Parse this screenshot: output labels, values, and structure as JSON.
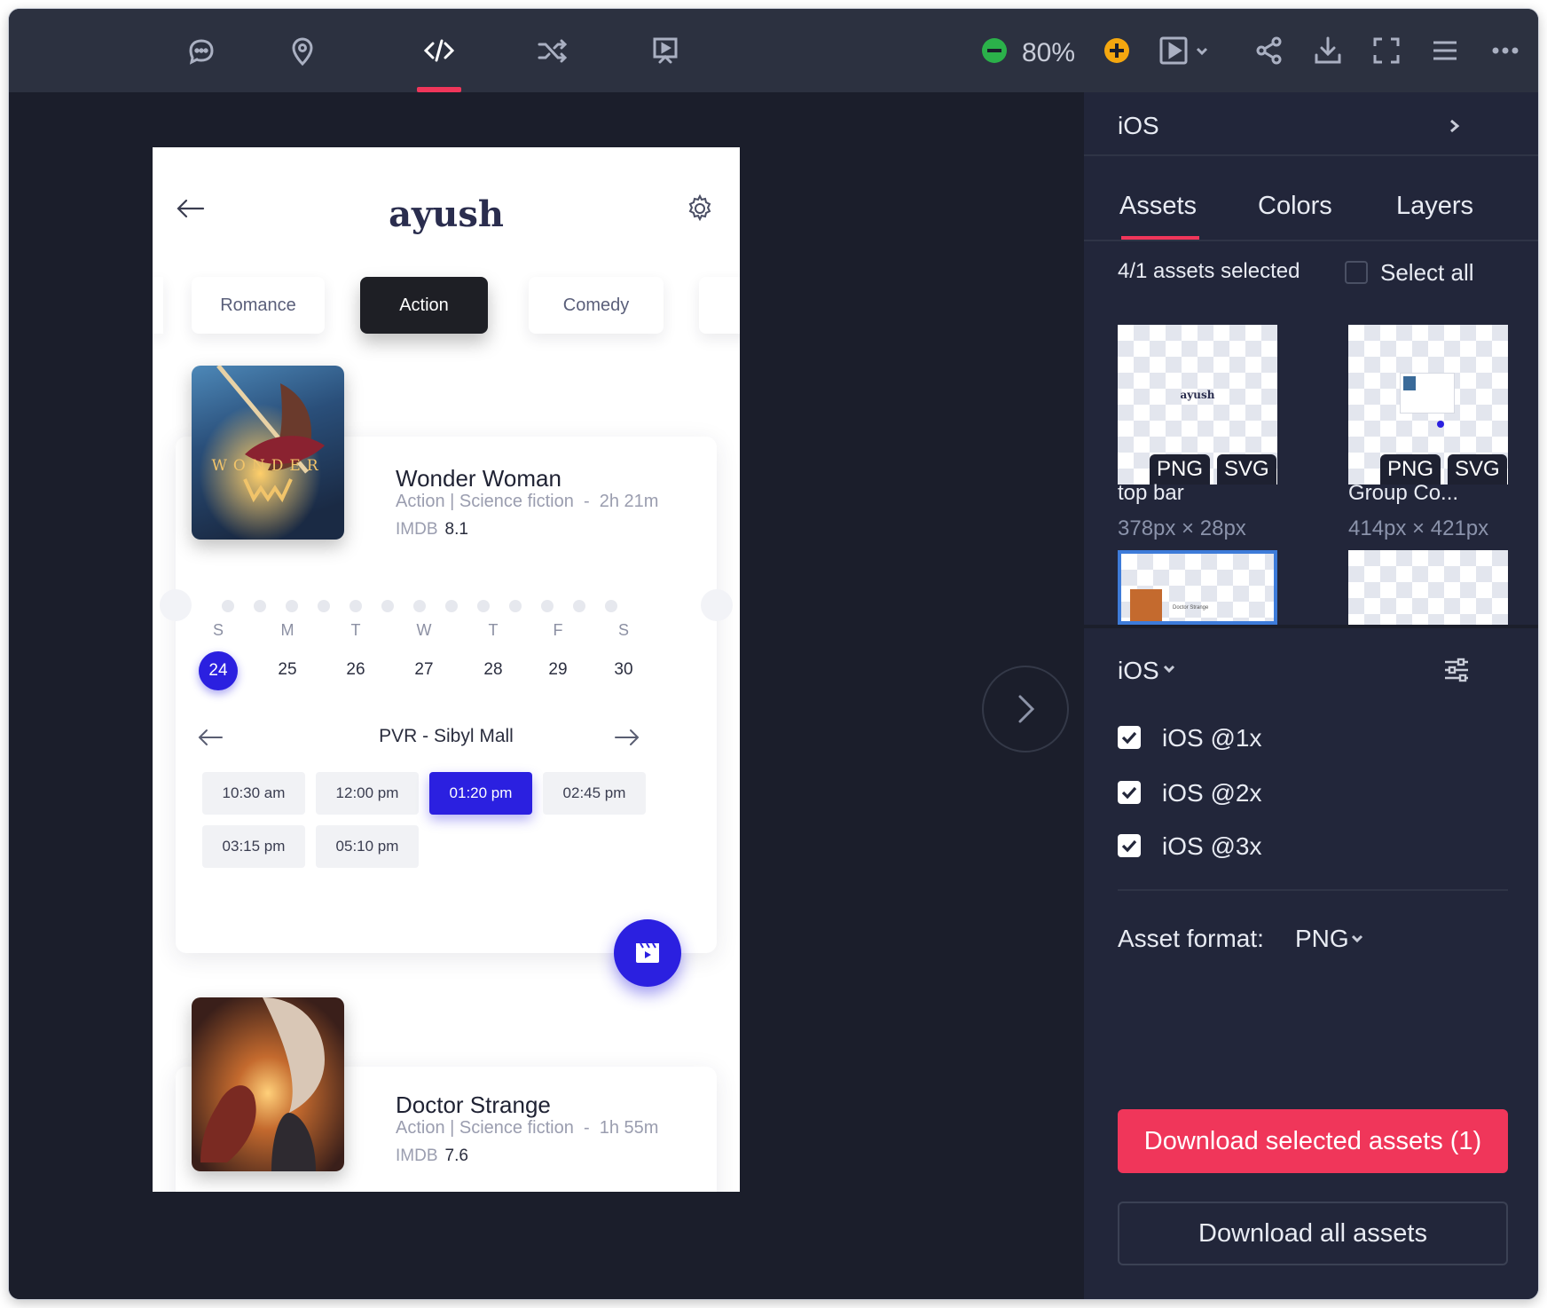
{
  "toolbar": {
    "icons": [
      "comment-icon",
      "location-pin-icon",
      "code-icon",
      "shuffle-icon",
      "presentation-icon"
    ],
    "zoom": "80%",
    "right_icons": [
      "zoom-out-icon",
      "zoom-in-icon",
      "play-icon",
      "chevron-down-icon",
      "share-icon",
      "download-icon",
      "fullscreen-icon",
      "menu-icon",
      "more-icon"
    ],
    "accent": "#f0365a"
  },
  "artboard": {
    "logo": "ayush",
    "categories": [
      "Romance",
      "Action",
      "Comedy"
    ],
    "active_category": "Action",
    "movies": [
      {
        "title": "Wonder Woman",
        "genre": "Action | Science fiction",
        "duration": "2h 21m",
        "imdb_label": "IMDB",
        "imdb": "8.1"
      },
      {
        "title": "Doctor Strange",
        "genre": "Action | Science fiction",
        "duration": "1h 55m",
        "imdb_label": "IMDB",
        "imdb": "7.6"
      }
    ],
    "poster_text": "WONDER",
    "days": [
      "S",
      "M",
      "T",
      "W",
      "T",
      "F",
      "S"
    ],
    "dates": [
      "24",
      "25",
      "26",
      "27",
      "28",
      "29",
      "30"
    ],
    "selected_date": "24",
    "theater": "PVR - Sibyl Mall",
    "times": [
      "10:30 am",
      "12:00 pm",
      "01:20 pm",
      "02:45 pm",
      "03:15 pm",
      "05:10 pm"
    ],
    "selected_time": "01:20 pm",
    "brand_color": "#2b20e0"
  },
  "panel": {
    "platform": "iOS",
    "tabs": [
      "Assets",
      "Colors",
      "Layers"
    ],
    "active_tab": "Assets",
    "selection_text": "4/1 assets selected",
    "select_all": "Select all",
    "assets": [
      {
        "name": "top bar",
        "dims": "378px × 28px",
        "formats": [
          "PNG",
          "SVG"
        ],
        "thumb_text": "ayush"
      },
      {
        "name": "Group Co...",
        "dims": "414px × 421px",
        "formats": [
          "PNG",
          "SVG"
        ]
      },
      {
        "name": "",
        "dims": "",
        "selected": true,
        "thumb_text": "Doctor Strange"
      },
      {
        "name": "",
        "dims": ""
      }
    ],
    "export_platform": "iOS",
    "scales": [
      {
        "label": "iOS @1x",
        "checked": true
      },
      {
        "label": "iOS @2x",
        "checked": true
      },
      {
        "label": "iOS @3x",
        "checked": true
      }
    ],
    "format_label": "Asset format:",
    "format_value": "PNG",
    "download_selected": "Download selected assets (1)",
    "download_all": "Download all assets"
  }
}
